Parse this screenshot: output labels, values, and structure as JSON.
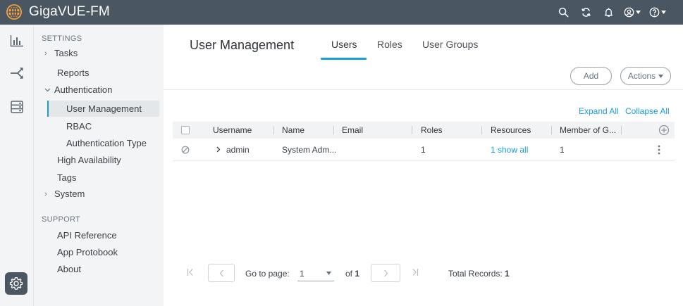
{
  "app": {
    "title": "GigaVUE-FM"
  },
  "topbar": {
    "icons": [
      "search-icon",
      "refresh-icon",
      "bell-icon",
      "user-icon",
      "help-icon"
    ]
  },
  "sidebar": {
    "settings_label": "SETTINGS",
    "support_label": "SUPPORT",
    "items": {
      "tasks": "Tasks",
      "reports": "Reports",
      "authentication": "Authentication",
      "user_management": "User Management",
      "rbac": "RBAC",
      "authentication_type": "Authentication Type",
      "high_availability": "High Availability",
      "tags": "Tags",
      "system": "System",
      "api_reference": "API Reference",
      "app_protobook": "App Protobook",
      "about": "About"
    }
  },
  "main": {
    "page_title": "User Management",
    "tabs": {
      "users": "Users",
      "roles": "Roles",
      "user_groups": "User Groups"
    },
    "active_tab": "Users",
    "buttons": {
      "add": "Add",
      "actions": "Actions"
    },
    "links": {
      "expand_all": "Expand All",
      "collapse_all": "Collapse All"
    },
    "table": {
      "headers": {
        "username": "Username",
        "name": "Name",
        "email": "Email",
        "roles": "Roles",
        "resources": "Resources",
        "member_of": "Member of G..."
      },
      "row": {
        "username": "admin",
        "name": "System Adm...",
        "email": "",
        "roles": "1",
        "resources": "1 show all",
        "member_of": "1"
      }
    },
    "pagination": {
      "go_to_page_label": "Go to page:",
      "current_page": "1",
      "of_label": "of",
      "total_pages": "1",
      "total_records_label": "Total Records:",
      "total_records": "1"
    }
  },
  "colors": {
    "topbar": "#4a5662",
    "accent": "#1a9ed8",
    "logo": "#f5a03a"
  }
}
